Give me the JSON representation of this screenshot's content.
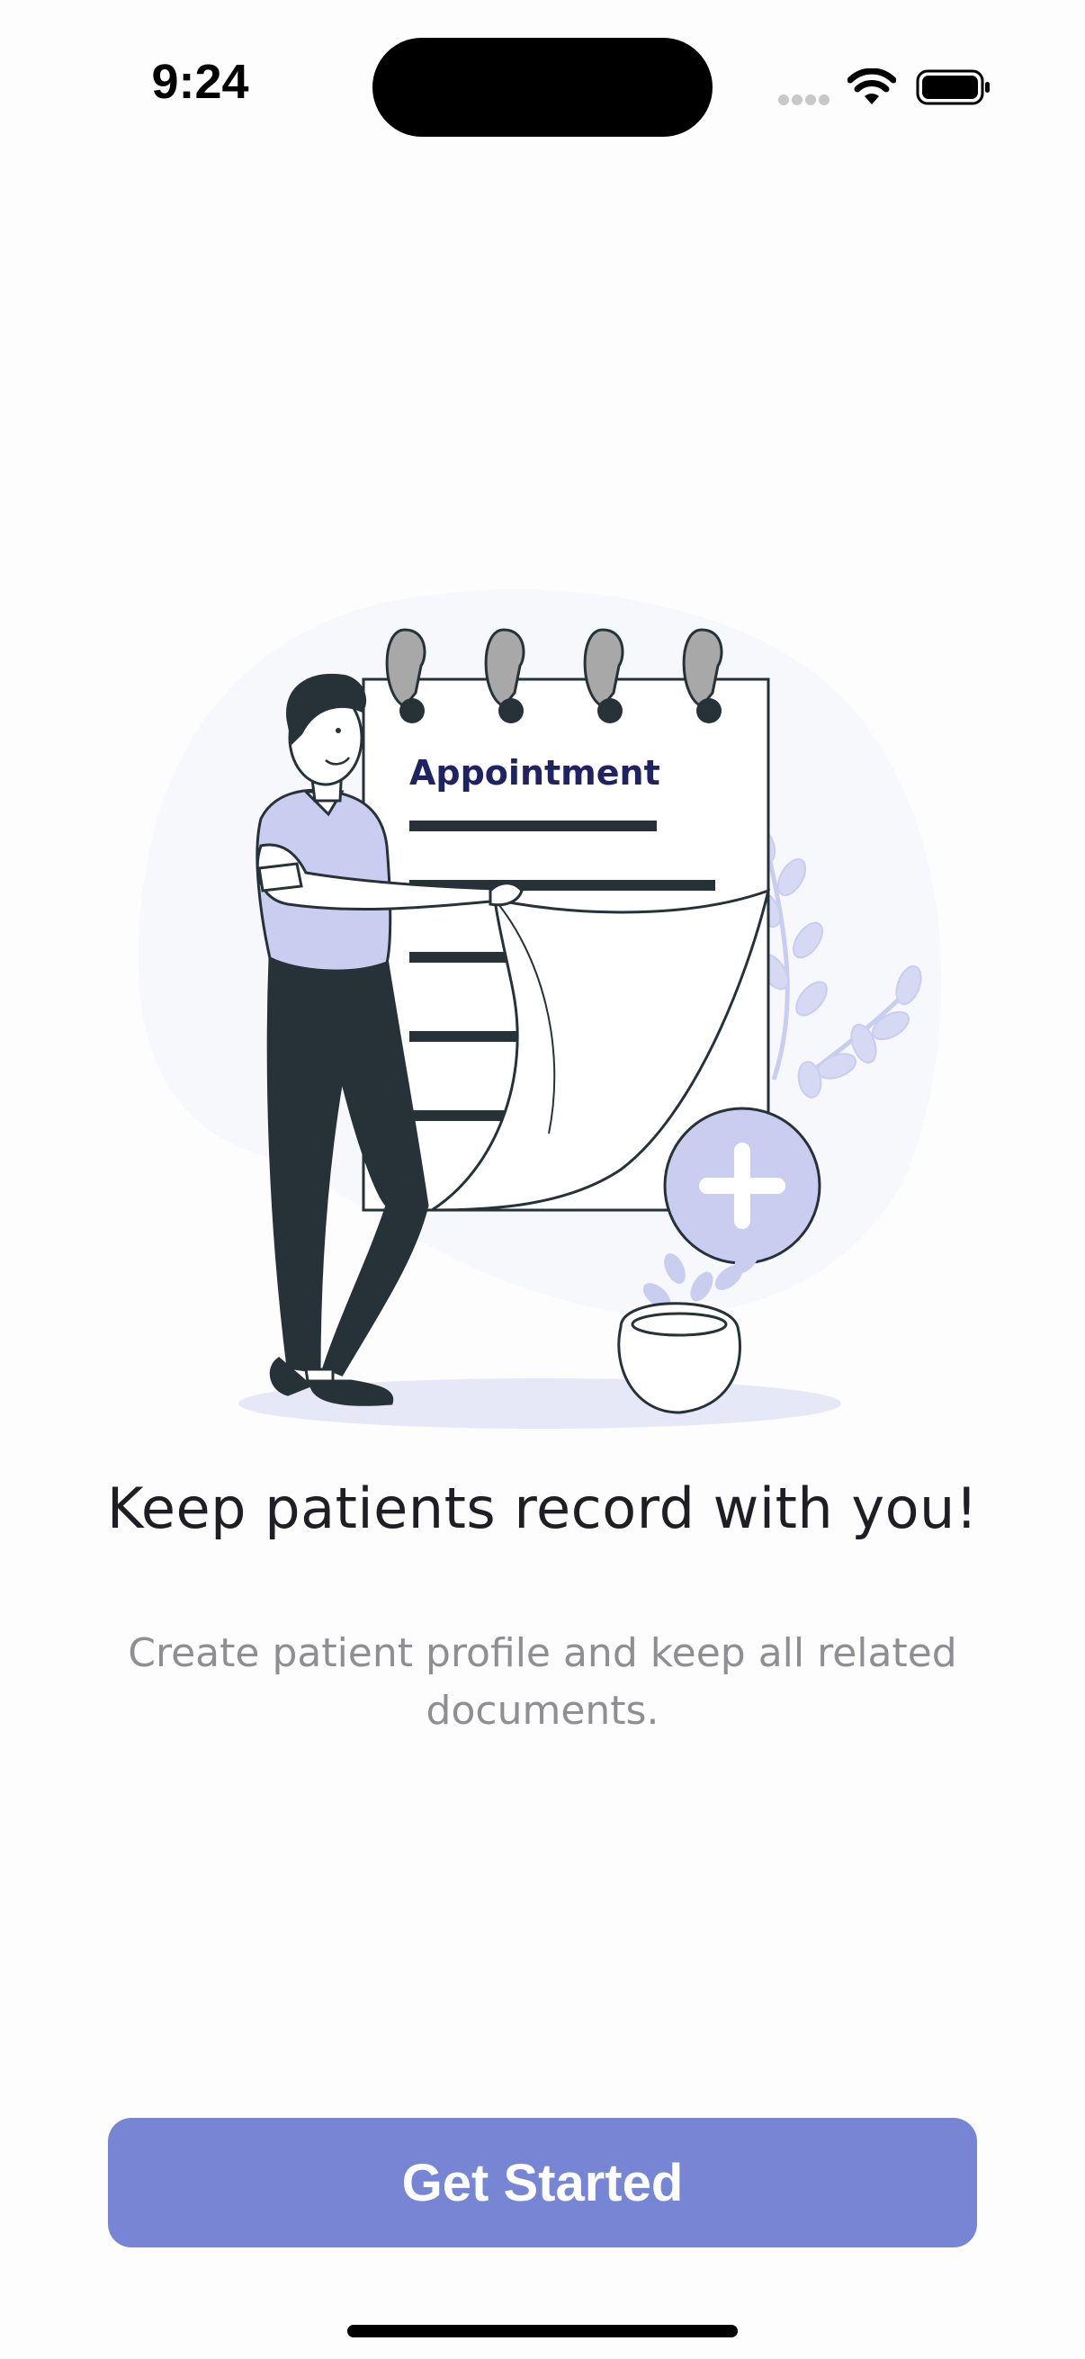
{
  "status_bar": {
    "time": "9:24"
  },
  "illustration": {
    "notebook_title": "Appointment",
    "icon": "add-plus-icon"
  },
  "onboarding": {
    "headline": "Keep patients record with you!",
    "description": "Create patient profile and keep all related documents."
  },
  "actions": {
    "get_started_label": "Get Started"
  },
  "colors": {
    "accent": "#7686d5",
    "accent_light": "#c9cdf0",
    "ink": "#263238",
    "notebook_title": "#1f2363",
    "headline": "#1e1e24",
    "subtext": "#8e8e93"
  }
}
